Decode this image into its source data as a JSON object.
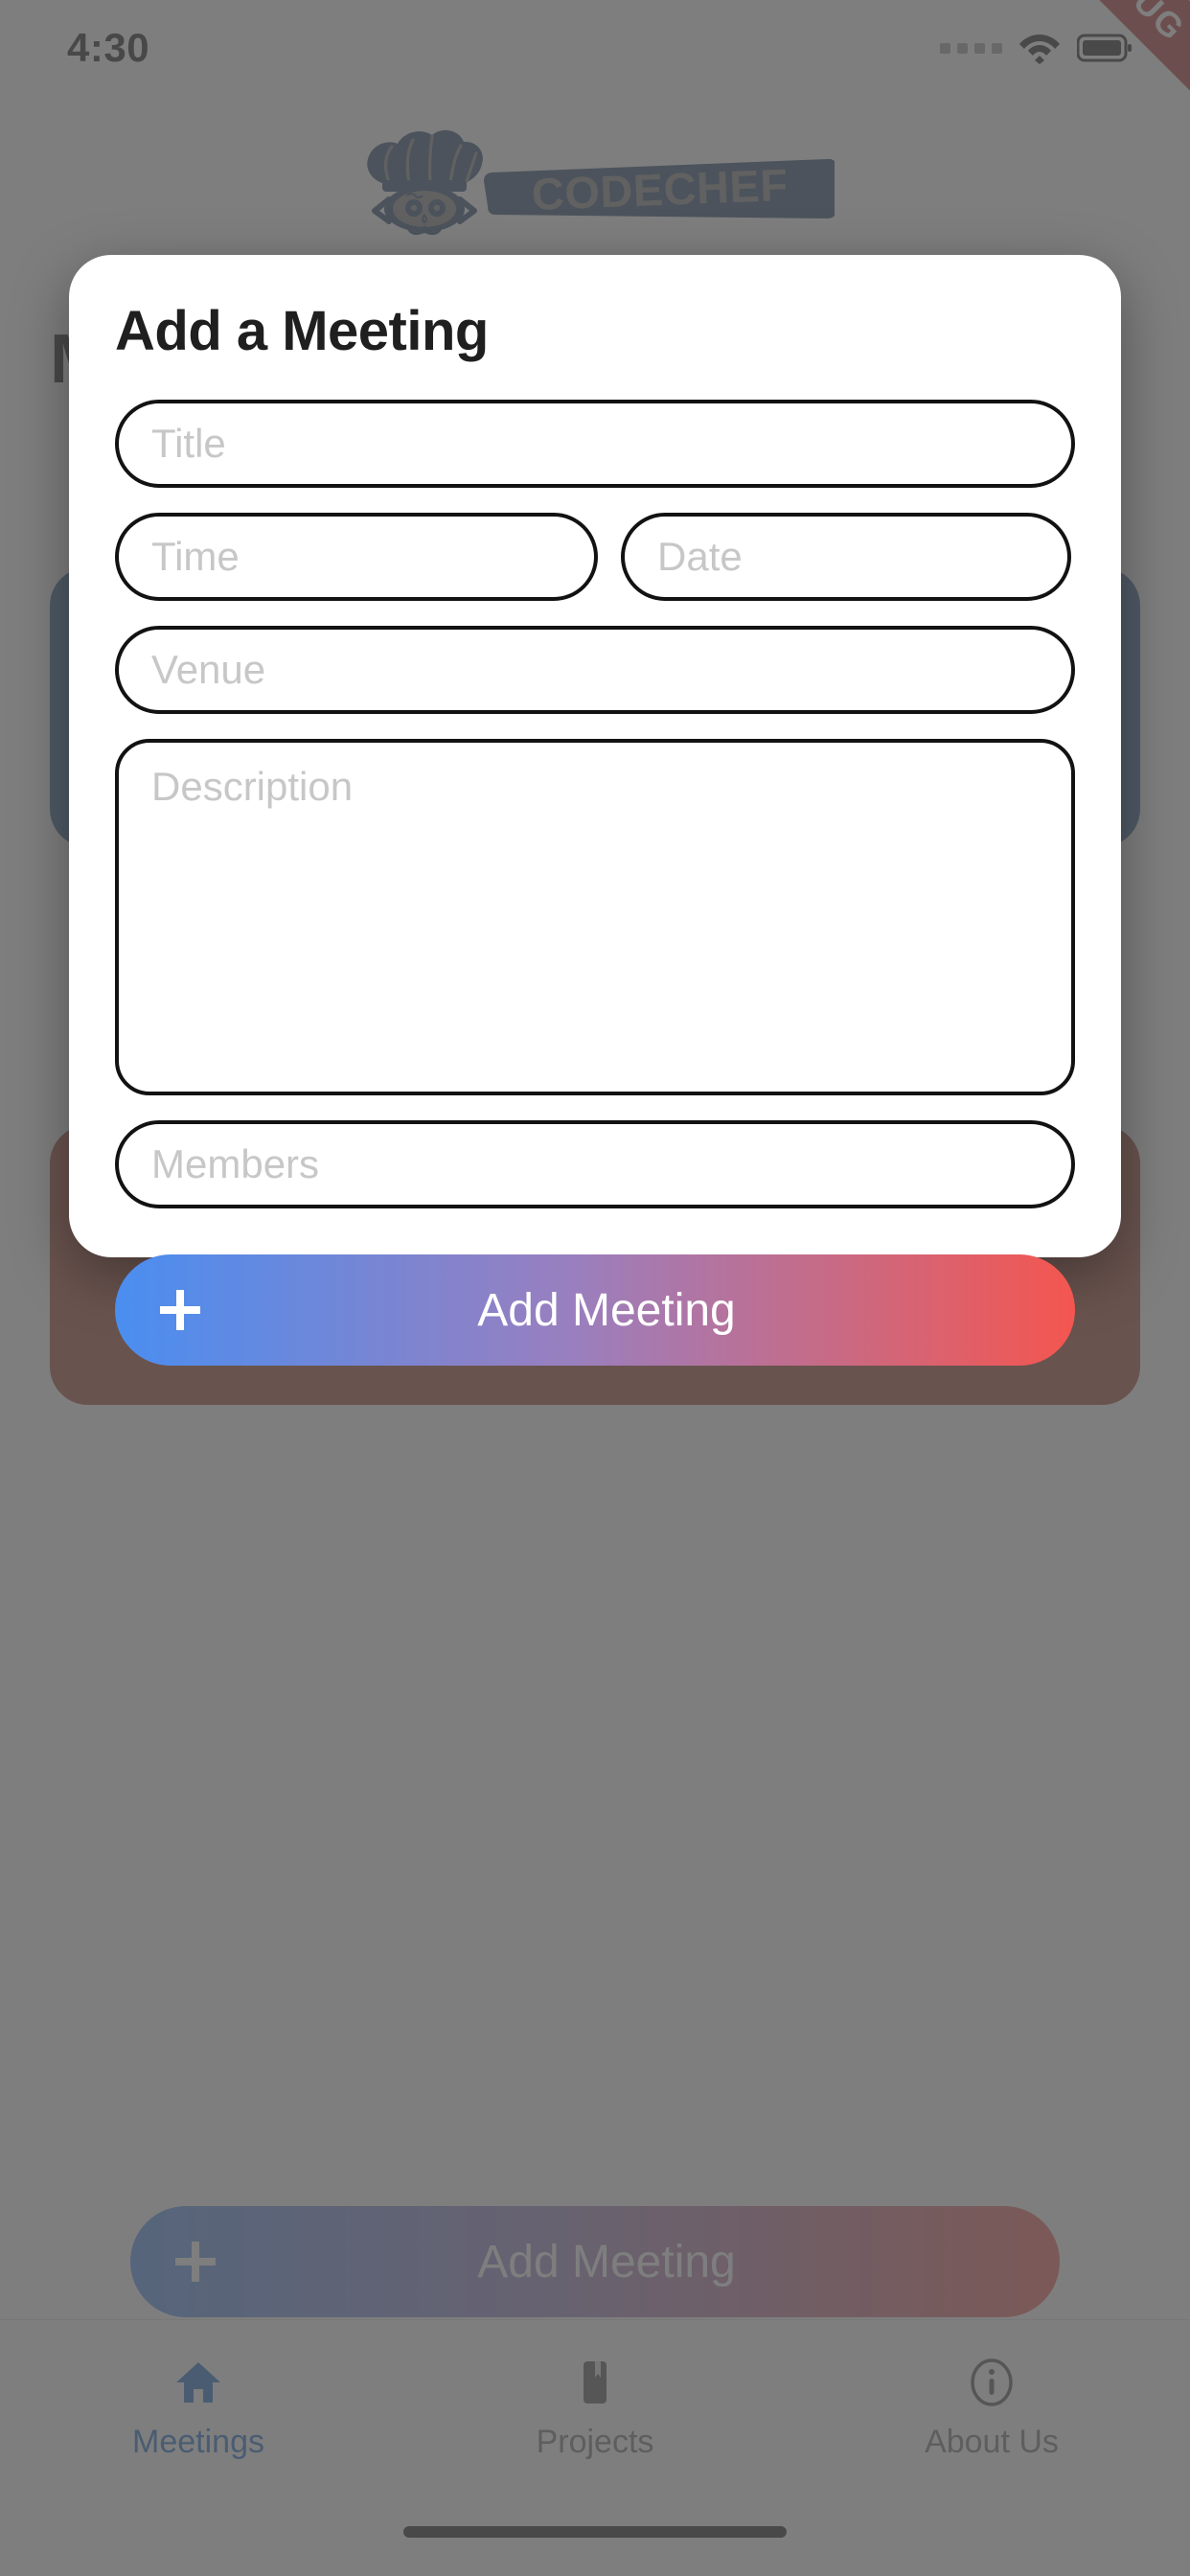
{
  "status_bar": {
    "time": "4:30",
    "signal_icon": "signal-dots-icon",
    "wifi_icon": "wifi-icon",
    "battery_icon": "battery-icon"
  },
  "debug_banner": {
    "label": "DEBUG",
    "color": "#b32424"
  },
  "brand": {
    "logo_icon": "codechef-logo",
    "wordmark": "CODECHEF",
    "color": "#1d3e64"
  },
  "page": {
    "title": "Meetings"
  },
  "background_cards": [
    {
      "name": "meeting-card-1",
      "color": "#2a5a93"
    },
    {
      "name": "meeting-card-2",
      "color": "#a03b28"
    }
  ],
  "background_add_button": {
    "label": "Add Meeting",
    "icon": "plus-icon",
    "gradient_from": "#4a8ef0",
    "gradient_to": "#f0574f"
  },
  "modal": {
    "title": "Add a Meeting",
    "fields": {
      "title": {
        "placeholder": "Title",
        "value": ""
      },
      "time": {
        "placeholder": "Time",
        "value": ""
      },
      "date": {
        "placeholder": "Date",
        "value": ""
      },
      "venue": {
        "placeholder": "Venue",
        "value": ""
      },
      "description": {
        "placeholder": "Description",
        "value": ""
      },
      "members": {
        "placeholder": "Members",
        "value": ""
      }
    },
    "submit": {
      "label": "Add Meeting",
      "icon": "plus-icon",
      "gradient_from": "#4a8ef0",
      "gradient_to": "#f4564f"
    }
  },
  "bottom_nav": {
    "active_color": "#1666c6",
    "inactive_color": "#6c6c6c",
    "items": [
      {
        "label": "Meetings",
        "icon": "home-icon",
        "active": true
      },
      {
        "label": "Projects",
        "icon": "bookmark-icon",
        "active": false
      },
      {
        "label": "About Us",
        "icon": "info-icon",
        "active": false
      }
    ]
  }
}
